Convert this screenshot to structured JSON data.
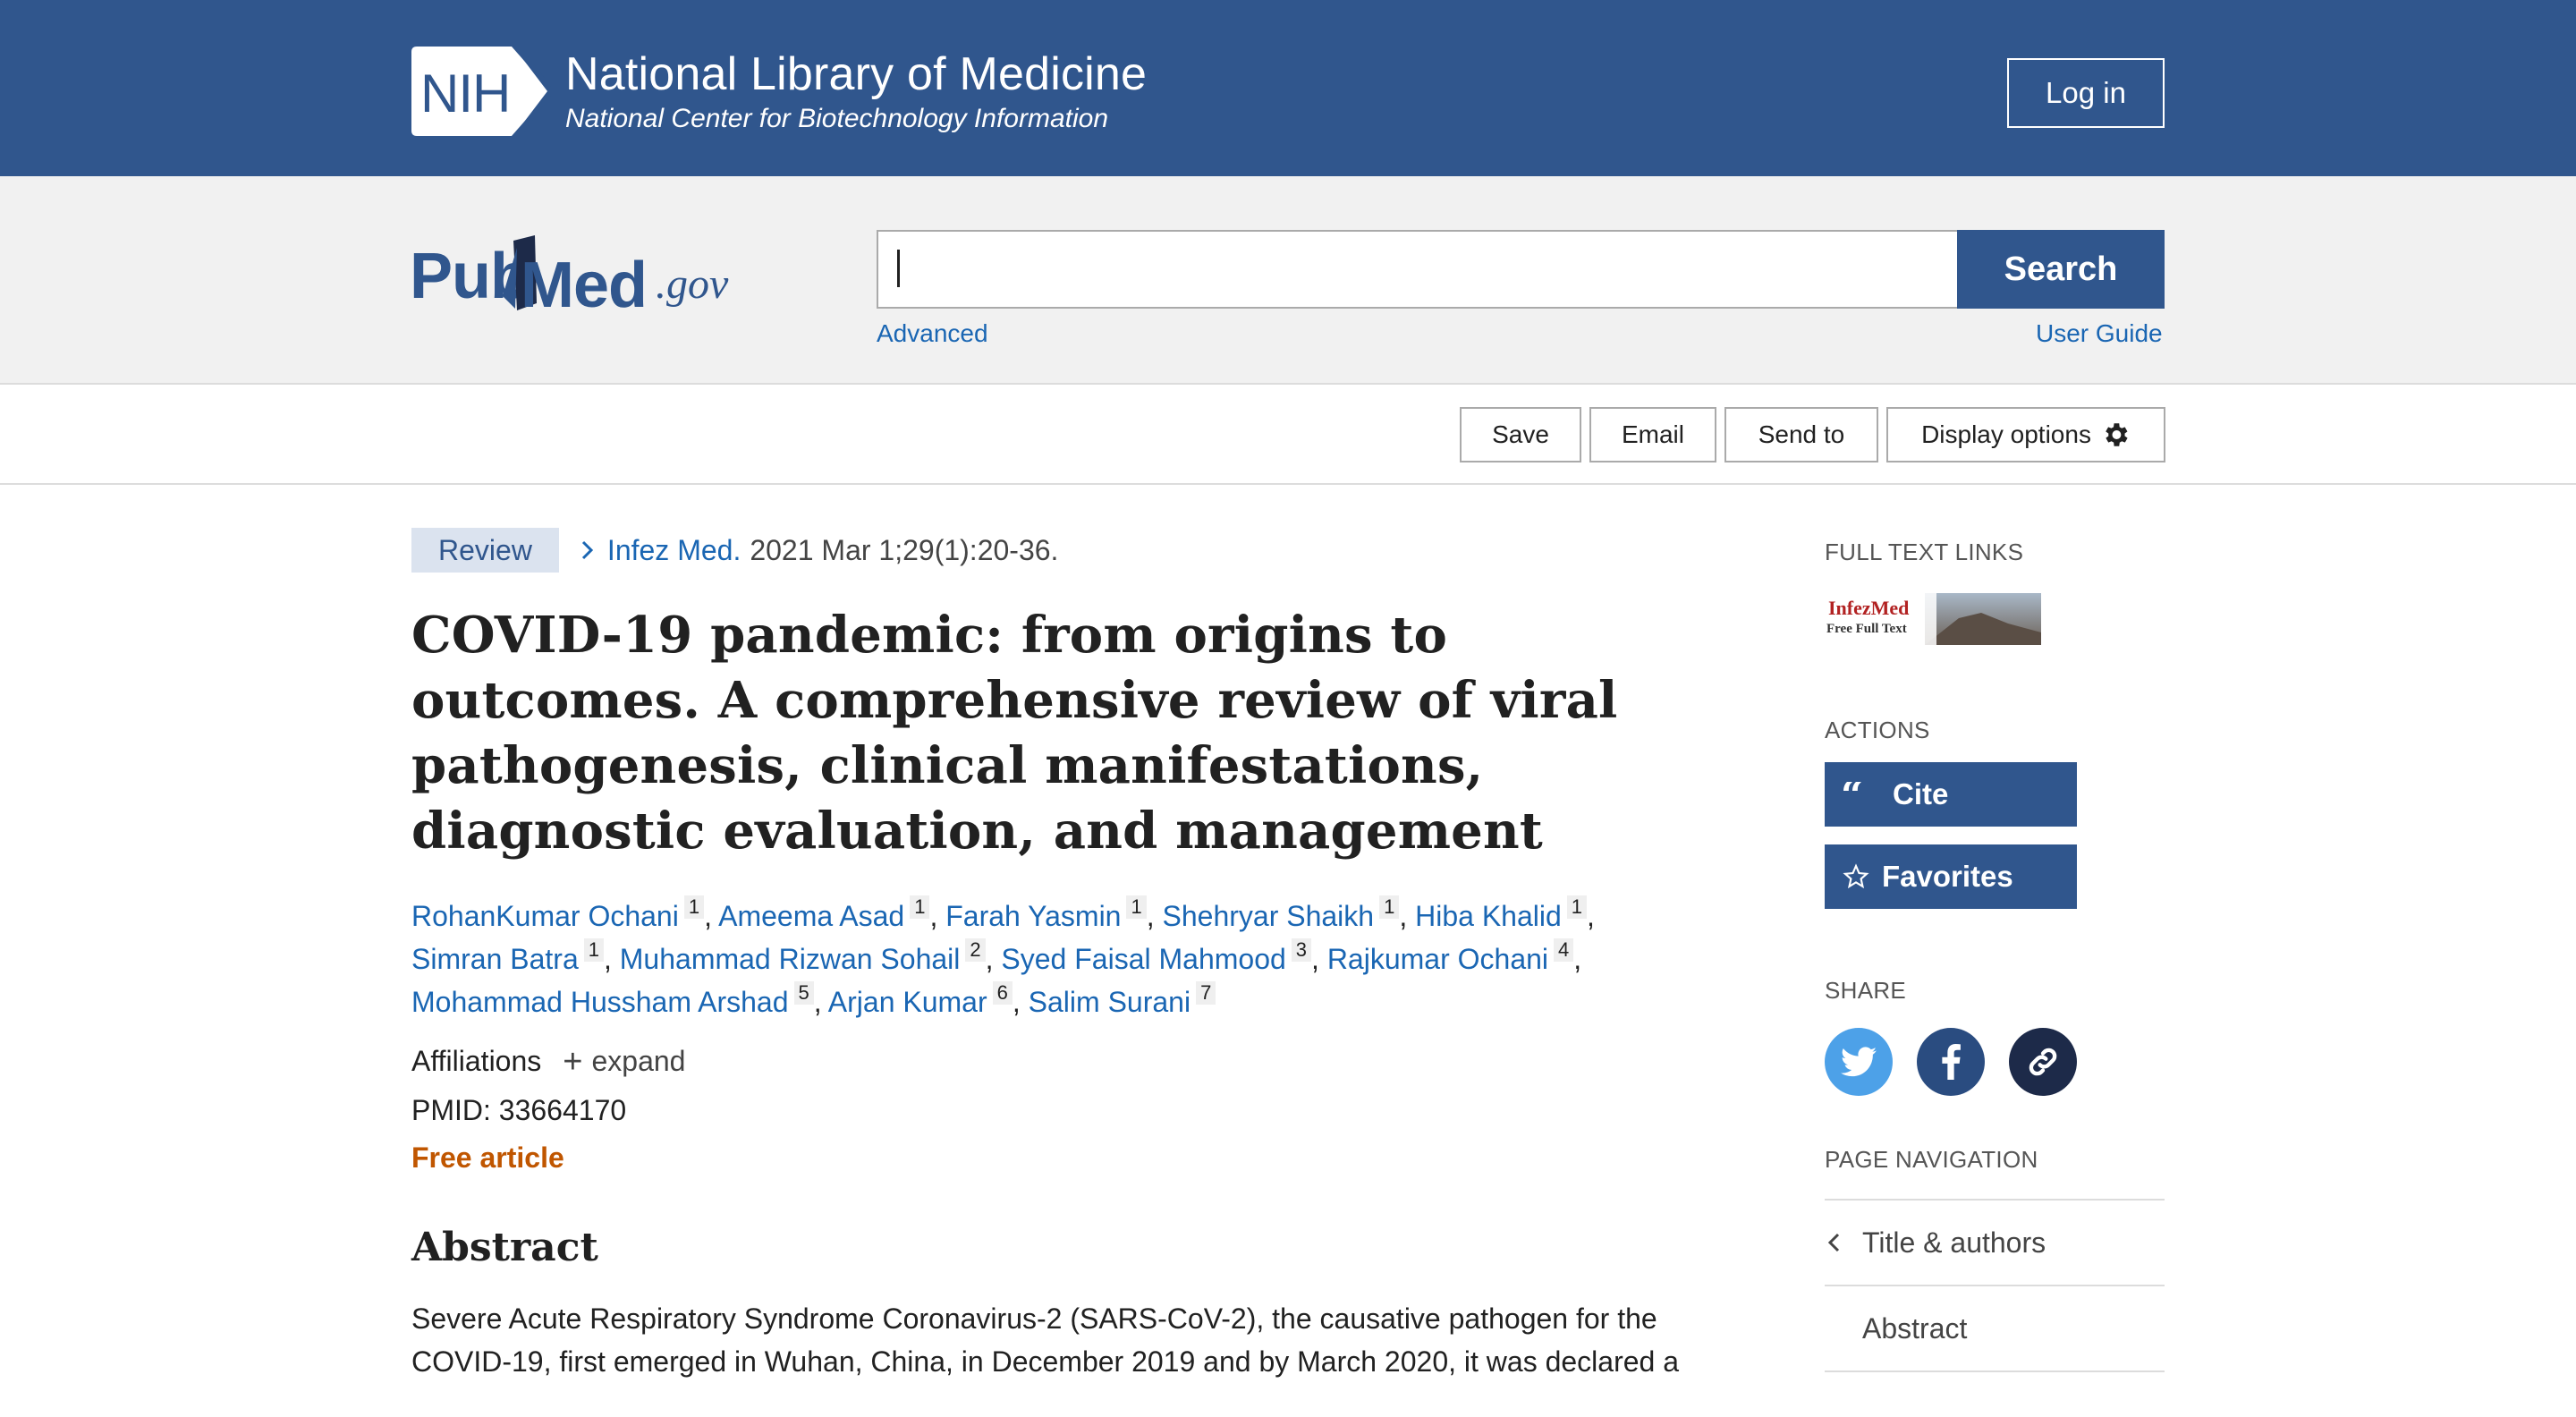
{
  "nih": {
    "badge": "NIH",
    "title": "National Library of Medicine",
    "subtitle": "National Center for Biotechnology Information",
    "login_label": "Log in"
  },
  "search": {
    "logo_pub": "Pub",
    "logo_med": "Med",
    "logo_gov": ".gov",
    "value": "",
    "button_label": "Search",
    "advanced_label": "Advanced",
    "user_guide_label": "User Guide"
  },
  "toolbar": {
    "save_label": "Save",
    "email_label": "Email",
    "send_to_label": "Send to",
    "display_options_label": "Display options"
  },
  "article": {
    "type_badge": "Review",
    "journal": "Infez Med.",
    "citation": "2021 Mar 1;29(1):20-36.",
    "title": "COVID-19 pandemic: from origins to outcomes. A comprehensive review of viral pathogenesis, clinical manifestations, diagnostic evaluation, and management",
    "authors": [
      {
        "name": "RohanKumar Ochani",
        "aff": "1"
      },
      {
        "name": "Ameema Asad",
        "aff": "1"
      },
      {
        "name": "Farah Yasmin",
        "aff": "1"
      },
      {
        "name": "Shehryar Shaikh",
        "aff": "1"
      },
      {
        "name": "Hiba Khalid",
        "aff": "1"
      },
      {
        "name": "Simran Batra",
        "aff": "1"
      },
      {
        "name": "Muhammad Rizwan Sohail",
        "aff": "2"
      },
      {
        "name": "Syed Faisal Mahmood",
        "aff": "3"
      },
      {
        "name": "Rajkumar Ochani",
        "aff": "4"
      },
      {
        "name": "Mohammad Hussham Arshad",
        "aff": "5"
      },
      {
        "name": "Arjan Kumar",
        "aff": "6"
      },
      {
        "name": "Salim Surani",
        "aff": "7"
      }
    ],
    "affiliations_label": "Affiliations",
    "expand_label": "expand",
    "pmid": "PMID: 33664170",
    "free_label": "Free article",
    "abstract_heading": "Abstract",
    "abstract_text_1": "Severe Acute Respiratory Syndrome Coronavirus-2 (SARS-CoV-2), the causative pathogen for the",
    "abstract_text_2": "COVID-19, first emerged in Wuhan, China, in December 2019 and by March 2020, it was declared a"
  },
  "sidebar": {
    "full_text_heading": "FULL TEXT LINKS",
    "full_text_logo": "InfezMed",
    "full_text_logo_sub": "Free Full Text",
    "actions_heading": "ACTIONS",
    "cite_label": "Cite",
    "favorites_label": "Favorites",
    "share_heading": "SHARE",
    "page_nav_heading": "PAGE NAVIGATION",
    "nav_items": [
      "Title & authors",
      "Abstract"
    ]
  },
  "colors": {
    "nih_blue": "#30568d",
    "link_blue": "#1a66b3",
    "free_orange": "#c05600",
    "twitter": "#4da1e8",
    "facebook": "#2a4c80",
    "copy_link": "#1d2a49"
  }
}
